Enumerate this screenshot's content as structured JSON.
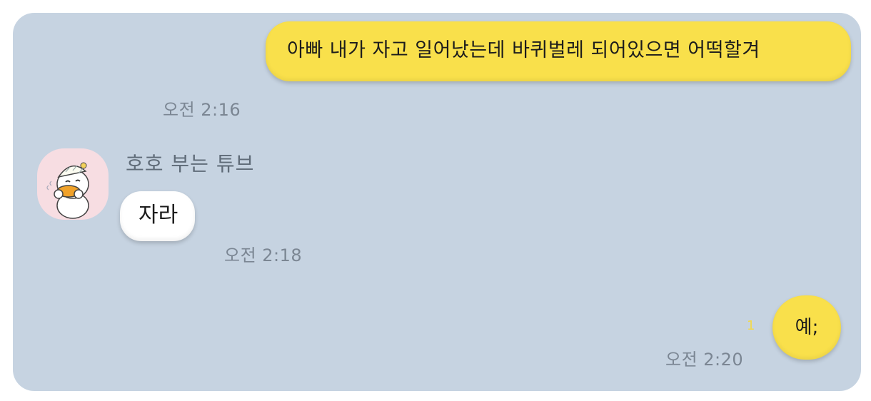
{
  "chat": {
    "messages": [
      {
        "from": "me",
        "text": "아빠 내가 자고 일어났는데 바퀴벌레 되어있으면 어떡할겨",
        "time": "오전 2:16"
      },
      {
        "from": "other",
        "sender": "호호 부는 튜브",
        "text": "자라",
        "time": "오전 2:18"
      },
      {
        "from": "me",
        "text": "예;",
        "time": "오전 2:20",
        "unread": "1"
      }
    ],
    "avatar_icon": "tube-duck-avatar-icon",
    "colors": {
      "background": "#c6d3e1",
      "my_bubble": "#f9e04b",
      "other_bubble": "#ffffff",
      "time_text": "#7b8693"
    }
  }
}
